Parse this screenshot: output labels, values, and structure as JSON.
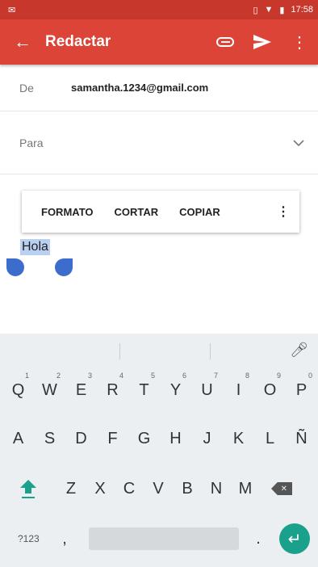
{
  "status": {
    "time": "17:58"
  },
  "appbar": {
    "title": "Redactar"
  },
  "compose": {
    "from_label": "De",
    "from_value": "samantha.1234@gmail.com",
    "to_label": "Para",
    "body": "Hola"
  },
  "popup": {
    "format": "FORMATO",
    "cut": "CORTAR",
    "copy": "COPIAR"
  },
  "keyboard": {
    "row1": [
      {
        "k": "Q",
        "n": "1"
      },
      {
        "k": "W",
        "n": "2"
      },
      {
        "k": "E",
        "n": "3"
      },
      {
        "k": "R",
        "n": "4"
      },
      {
        "k": "T",
        "n": "5"
      },
      {
        "k": "Y",
        "n": "6"
      },
      {
        "k": "U",
        "n": "7"
      },
      {
        "k": "I",
        "n": "8"
      },
      {
        "k": "O",
        "n": "9"
      },
      {
        "k": "P",
        "n": "0"
      }
    ],
    "row2": [
      "A",
      "S",
      "D",
      "F",
      "G",
      "H",
      "J",
      "K",
      "L",
      "Ñ"
    ],
    "row3": [
      "Z",
      "X",
      "C",
      "V",
      "B",
      "N",
      "M"
    ],
    "symbols_label": "?123",
    "comma": ",",
    "period": "."
  },
  "colors": {
    "appbar": "#db4437",
    "statusbar": "#c8372b",
    "accent": "#1aa18b",
    "selection": "#b9d0f3"
  }
}
